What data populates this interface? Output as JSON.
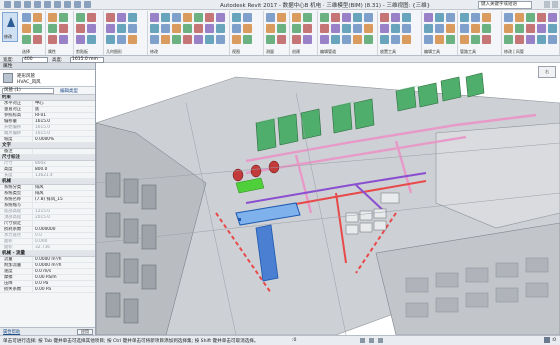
{
  "app": {
    "title": "Autodesk Revit 2017 -     数据中心B 机电 · 三维模型(BIM)  (8.31)  - 三维视图: {三维}",
    "search_placeholder": "键入关键字或短语"
  },
  "ribbon": {
    "modify_label": "修改",
    "groups": [
      "选择",
      "属性",
      "剪贴板",
      "几何图形",
      "修改",
      "视图",
      "测量",
      "创建",
      "编辑管道",
      "放置工具",
      "编辑工具",
      "管路工具",
      "修改 | 风管"
    ]
  },
  "options_bar": {
    "width_label": "宽度:",
    "width_value": "400",
    "height_label": "高度:",
    "height_value": "1615.0 mm"
  },
  "properties": {
    "header": "属性",
    "type_line1": "矩形风管",
    "type_line2": "HVAC_风风",
    "instance_selector": "风管 (1)",
    "edit_type": "编辑类型",
    "sections": [
      {
        "title": "约束",
        "rows": [
          {
            "k": "水平对正",
            "v": "中心",
            "dim": false
          },
          {
            "k": "垂直对正",
            "v": "底",
            "dim": false
          },
          {
            "k": "参照标高",
            "v": "RF01",
            "dim": false
          },
          {
            "k": "偏移量",
            "v": "1615.0",
            "dim": false
          },
          {
            "k": "开始偏移",
            "v": "1615.0",
            "dim": true
          },
          {
            "k": "端点偏移",
            "v": "1615.0",
            "dim": true
          },
          {
            "k": "坡度",
            "v": "0.0000%",
            "dim": false
          }
        ]
      },
      {
        "title": "文字",
        "rows": [
          {
            "k": "备注",
            "v": "",
            "dim": false
          }
        ]
      },
      {
        "title": "尺寸标注",
        "rows": [
          {
            "k": "尺寸",
            "v": "800x",
            "dim": true
          },
          {
            "k": "高度",
            "v": "800.0",
            "dim": false
          },
          {
            "k": "长度",
            "v": "13621.4",
            "dim": true
          }
        ]
      },
      {
        "title": "机械",
        "rows": [
          {
            "k": "系统分类",
            "v": "排风",
            "dim": false
          },
          {
            "k": "系统类型",
            "v": "排风",
            "dim": false
          },
          {
            "k": "系统名称",
            "v": "(7.8) 排风_15",
            "dim": false
          },
          {
            "k": "系统缩写",
            "v": "",
            "dim": false
          },
          {
            "k": "底部高程",
            "v": "1215.0",
            "dim": true
          },
          {
            "k": "顶部高程",
            "v": "2015.0",
            "dim": true
          },
          {
            "k": "尺寸锁定",
            "v": "",
            "dim": false
          },
          {
            "k": "损耗系数",
            "v": "0.000000",
            "dim": false
          },
          {
            "k": "水力直径",
            "v": "0.0",
            "dim": true
          },
          {
            "k": "面积",
            "v": "0.000",
            "dim": true
          },
          {
            "k": "面积",
            "v": "32.736",
            "dim": true
          }
        ]
      },
      {
        "title": "机械 - 流量",
        "rows": [
          {
            "k": "流量",
            "v": "0.0000 m³/h",
            "dim": false
          },
          {
            "k": "附加流量",
            "v": "0.0000 m³/h",
            "dim": false
          },
          {
            "k": "速度",
            "v": "0.0 m/s",
            "dim": false
          },
          {
            "k": "摩擦",
            "v": "0.00 Pa/m",
            "dim": false
          },
          {
            "k": "压降",
            "v": "0.0 Pa",
            "dim": false
          },
          {
            "k": "损失系数",
            "v": "0.00 Pa",
            "dim": false
          }
        ]
      }
    ],
    "help_link": "属性帮助",
    "apply_label": "应用"
  },
  "viewport": {
    "viewcube_label": "右"
  },
  "status_bar": {
    "message": "单击可进行选择; 按 Tab 键并单击可选择其他项目; 按 Ctrl 键并单击可将新项目添加到选择集; 按 Shift 键并单击可取消选择。",
    "model": ":0",
    "filter": ":0"
  },
  "colors": {
    "equipment_green": "#4fae6c",
    "duct_pink": "#e79ac8",
    "duct_blue": "#4a7fd1",
    "pipe_red": "#e84a4a",
    "pipe_purple": "#8a4fd0",
    "cable_green": "#4fd03a",
    "building_gray": "#c9ccd0",
    "ribbon_bg": "#f3f5f8"
  }
}
